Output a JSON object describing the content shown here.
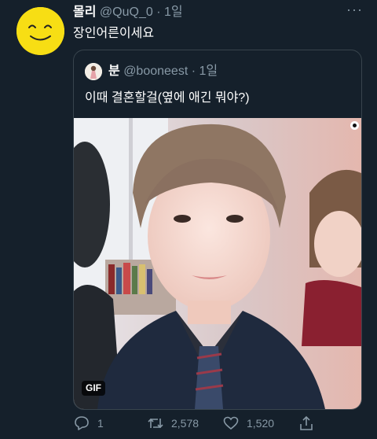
{
  "tweet": {
    "display_name": "몰리",
    "handle": "@QuQ_0",
    "separator": "·",
    "time": "1일",
    "text": "장인어른이세요",
    "more_label": "···"
  },
  "quoted_tweet": {
    "display_name": "분",
    "handle": "@booneest",
    "separator": "·",
    "time": "1일",
    "text": "이때 결혼할걸(옆에 애긴 뭐야?)",
    "media_badge": "GIF"
  },
  "actions": {
    "reply_count": "1",
    "retweet_count": "2,578",
    "like_count": "1,520"
  },
  "colors": {
    "background": "#15202b",
    "muted": "#8899a6",
    "border": "#38444d",
    "avatar_yellow": "#f7de14"
  }
}
